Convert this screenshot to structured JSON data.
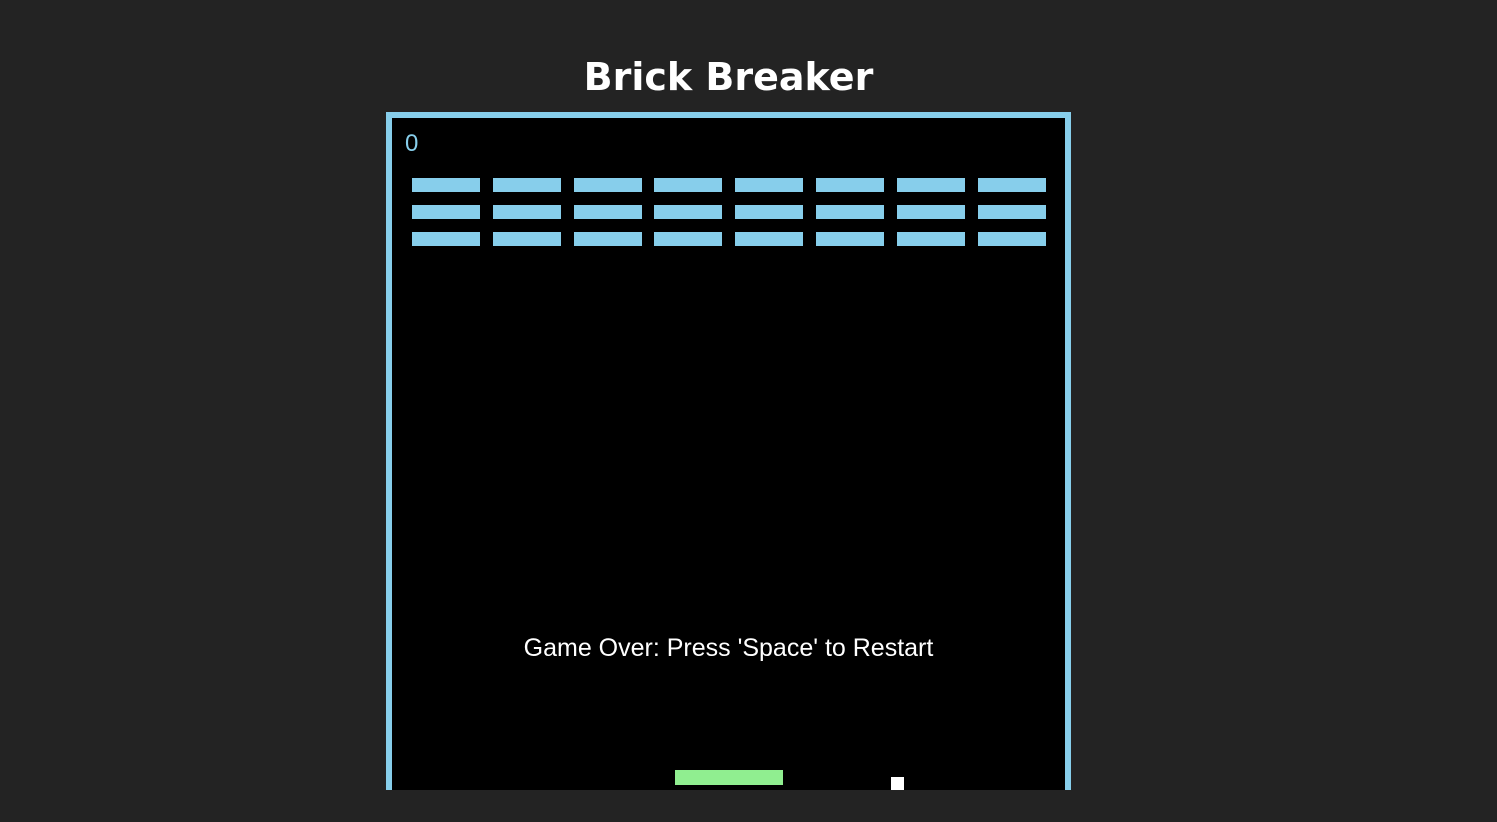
{
  "page": {
    "title": "Brick Breaker"
  },
  "game": {
    "score": "0",
    "message": "Game Over: Press 'Space' to Restart",
    "state": "game-over",
    "brick_rows": 3,
    "brick_columns": 8,
    "colors": {
      "background": "#232323",
      "board": "#000000",
      "border": "#87ceeb",
      "brick": "#87ceeb",
      "paddle": "#90ee90",
      "ball": "#ffffff",
      "score": "#87ceeb"
    }
  }
}
